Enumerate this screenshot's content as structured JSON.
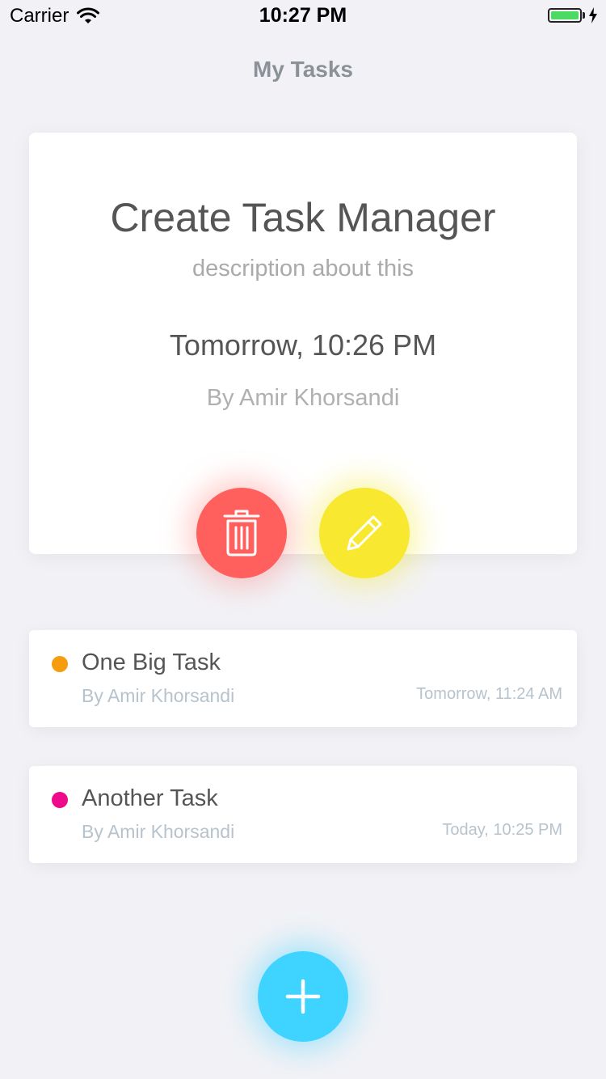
{
  "status_bar": {
    "carrier": "Carrier",
    "time": "10:27 PM",
    "battery_level": 1.0
  },
  "nav": {
    "title": "My Tasks"
  },
  "featured_task": {
    "title": "Create Task Manager",
    "description": "description about this",
    "date": "Tomorrow, 10:26 PM",
    "author": "By Amir Khorsandi",
    "delete_icon": "trash-icon",
    "edit_icon": "pencil-icon"
  },
  "tasks": [
    {
      "title": "One Big Task",
      "author": "By Amir Khorsandi",
      "date": "Tomorrow, 11:24 AM",
      "color": "#f59c0f"
    },
    {
      "title": "Another Task",
      "author": "By Amir Khorsandi",
      "date": "Today, 10:25 PM",
      "color": "#ee0a8a"
    }
  ],
  "add_button": {
    "icon": "plus-icon"
  },
  "colors": {
    "delete": "#ff5f5d",
    "edit": "#f8e82f",
    "add": "#3fd4ff",
    "battery": "#4cd964"
  }
}
